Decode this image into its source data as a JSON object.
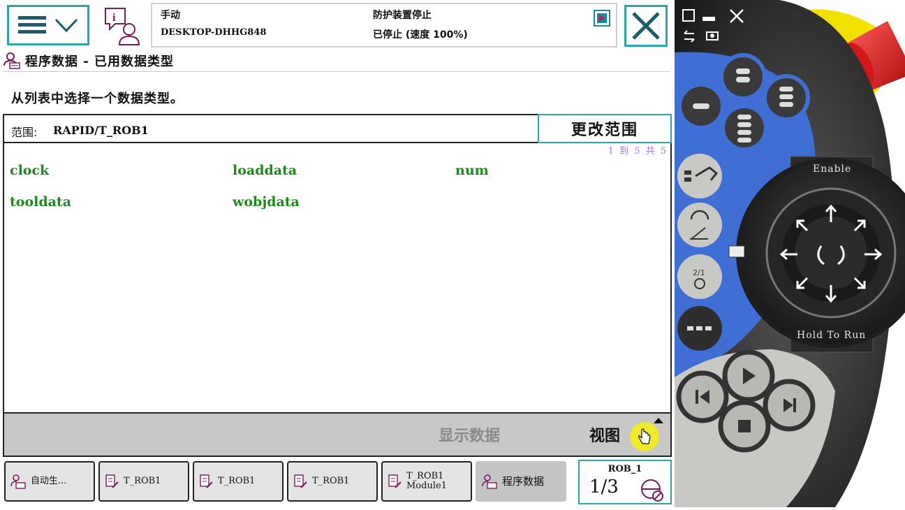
{
  "header": {
    "mode": "手动",
    "system_name": "DESKTOP-DHHG848",
    "safety_state": "防护装置停止",
    "run_state": "已停止 (速度 100%)"
  },
  "title": "程序数据 - 已用数据类型",
  "instruction": "从列表中选择一个数据类型。",
  "scope": {
    "label": "范围:",
    "value": "RAPID/T_ROB1",
    "button": "更改范围"
  },
  "list": {
    "page_info": "1 到 5 共 5",
    "items": [
      "clock",
      "loaddata",
      "num",
      "tooldata",
      "wobjdata"
    ]
  },
  "command_bar": {
    "show_data": "显示数据",
    "view": "视图"
  },
  "taskbar": {
    "tasks": [
      {
        "label": "自动生..."
      },
      {
        "label": "T_ROB1"
      },
      {
        "label": "T_ROB1"
      },
      {
        "label": "T_ROB1"
      },
      {
        "label": "T_ROB1\nModule1"
      },
      {
        "label": "程序数据"
      }
    ],
    "rob_label": "ROB_1",
    "speed_fraction": "1/3"
  },
  "pendant": {
    "enable_label": "Enable",
    "hold_label": "Hold To Run"
  },
  "colors": {
    "accent": "#2aa6a8",
    "list_text": "#1e8a1e",
    "page_info": "#a474e0",
    "pendant_blue": "#3f6fd4",
    "emergency_stop": "#e02020",
    "pendant_yellow": "#f2e100"
  }
}
